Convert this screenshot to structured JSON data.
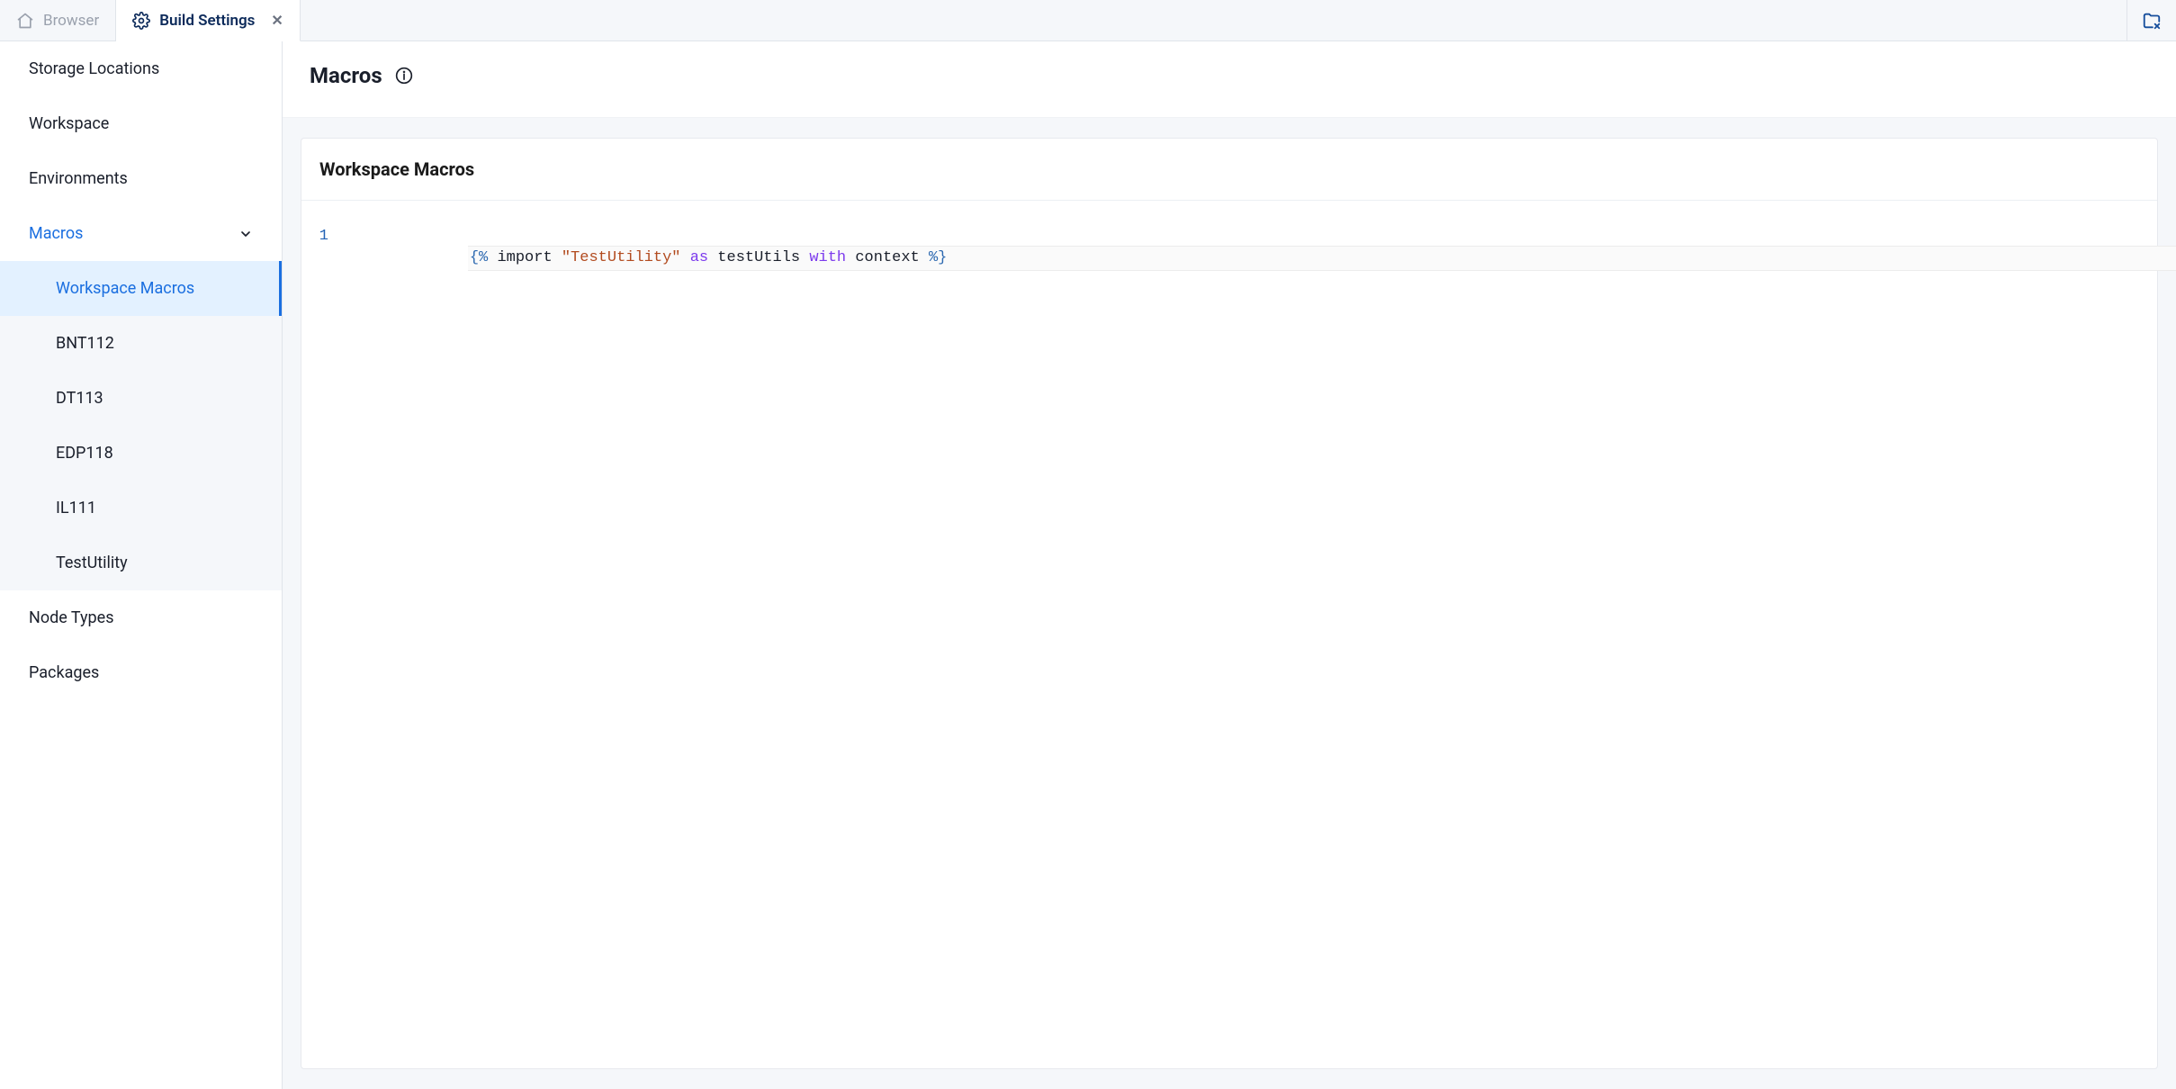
{
  "tabs": {
    "browser_label": "Browser",
    "build_settings_label": "Build Settings"
  },
  "sidebar": {
    "items": {
      "storage_locations": "Storage Locations",
      "workspace": "Workspace",
      "environments": "Environments",
      "macros": "Macros",
      "node_types": "Node Types",
      "packages": "Packages"
    },
    "macros_children": {
      "workspace_macros": "Workspace Macros",
      "bnt112": "BNT112",
      "dt113": "DT113",
      "edp118": "EDP118",
      "il111": "IL111",
      "test_utility": "TestUtility"
    }
  },
  "page": {
    "title": "Macros"
  },
  "panel": {
    "title": "Workspace Macros"
  },
  "editor": {
    "line_number": "1",
    "tokens": {
      "open_delim": "{%",
      "import_kw": "import",
      "str_lit": "\"TestUtility\"",
      "as_kw": "as",
      "alias": "testUtils",
      "with_kw": "with",
      "ctx": "context",
      "close_delim": "%}"
    }
  }
}
